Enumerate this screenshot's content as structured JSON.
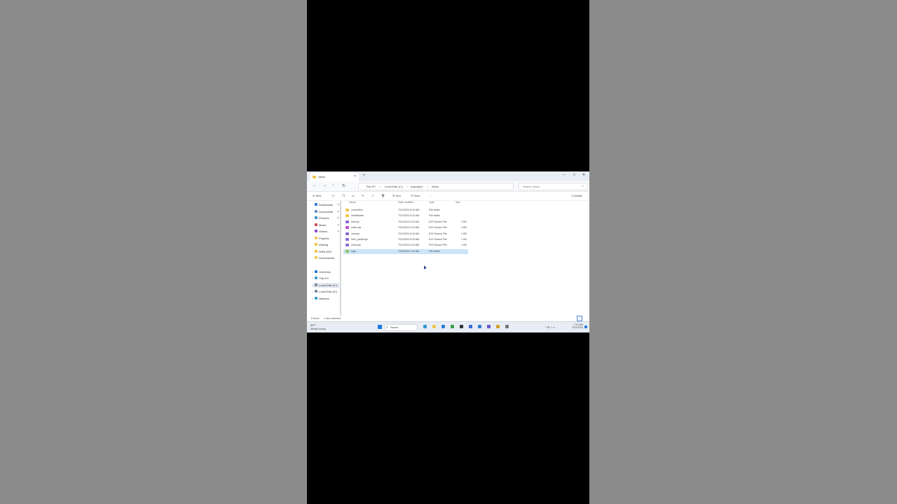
{
  "window": {
    "tab_title": "views",
    "tab_close": "×",
    "new_tab": "+",
    "controls": {
      "minimize": "–",
      "maximize": "□",
      "close": "✕"
    }
  },
  "addressbar": {
    "nav": {
      "back": "←",
      "forward": "→",
      "up": "↑",
      "refresh": "↻"
    },
    "crumbs": [
      "This PC",
      "Local Disk (C:)",
      "myproject",
      "views"
    ],
    "separator": "›",
    "search_placeholder": "Search views",
    "search_glyph": "⌕"
  },
  "toolbar": {
    "new": "New",
    "sort": "Sort",
    "view": "View",
    "more": "···",
    "details": "Details"
  },
  "nav_pane": {
    "quick_access": [
      {
        "label": "Downloads",
        "pin": "⊿",
        "color": "#2f7bd6"
      },
      {
        "label": "Documents",
        "pin": "⊿",
        "color": "#6a8fc7"
      },
      {
        "label": "Pictures",
        "pin": "⊿",
        "color": "#3c8fd0"
      },
      {
        "label": "Music",
        "pin": "⊿",
        "color": "#d64a5a"
      },
      {
        "label": "Videos",
        "pin": "⊿",
        "color": "#8a4ad6"
      },
      {
        "label": "Projects",
        "pin": "",
        "color": "#f3c44d"
      },
      {
        "label": "myblog",
        "pin": "",
        "color": "#f3c44d"
      },
      {
        "label": "WEB-DEV",
        "pin": "",
        "color": "#f3c44d"
      },
      {
        "label": "Screenshots",
        "pin": "",
        "color": "#f3c44d"
      }
    ],
    "drives": [
      {
        "label": "OneDrive",
        "color": "#2f7bd6",
        "selected": false
      },
      {
        "label": "This PC",
        "color": "#3aa0c8",
        "selected": false
      },
      {
        "label": "Local Disk (C:)",
        "color": "#7a8a9a",
        "selected": true
      },
      {
        "label": "Local Disk (D:)",
        "color": "#7a8a9a",
        "selected": false
      },
      {
        "label": "Network",
        "color": "#3aa0c8",
        "selected": false
      }
    ],
    "chevron": "›"
  },
  "file_list": {
    "headers": {
      "name": "Name",
      "date": "Date modified",
      "type": "Type",
      "size": "Size"
    },
    "rows": [
      {
        "name": "controllers",
        "date": "7/21/2024 5:10 AM",
        "type": "File folder",
        "size": "",
        "icon": "folder-icon",
        "color": "#f3c44d",
        "selected": false
      },
      {
        "name": "middleware",
        "date": "7/21/2024 5:10 AM",
        "type": "File folder",
        "size": "",
        "icon": "folder-icon",
        "color": "#f3c44d",
        "selected": false
      },
      {
        "name": "edit.ejs",
        "date": "7/21/2024 5:10 AM",
        "type": "EJS Source File",
        "size": "2 KB",
        "icon": "code-file-icon",
        "color": "#8a6ad6",
        "selected": false
      },
      {
        "name": "index.ejs",
        "date": "7/21/2024 5:10 AM",
        "type": "EJS Source File",
        "size": "2 KB",
        "icon": "code-file-icon",
        "color": "#c04ad6",
        "selected": false
      },
      {
        "name": "new.ejs",
        "date": "7/21/2024 5:10 AM",
        "type": "EJS Source File",
        "size": "2 KB",
        "icon": "code-file-icon",
        "color": "#8a6ad6",
        "selected": false
      },
      {
        "name": "new_partial.ejs",
        "date": "7/21/2024 5:10 AM",
        "type": "EJS Source File",
        "size": "1 KB",
        "icon": "code-file-icon",
        "color": "#8a6ad6",
        "selected": false
      },
      {
        "name": "show.ejs",
        "date": "7/21/2024 5:10 AM",
        "type": "EJS Source File",
        "size": "1 KB",
        "icon": "code-file-icon",
        "color": "#8a6ad6",
        "selected": false
      },
      {
        "name": "logs",
        "date": "7/21/2024 7:10 AM",
        "type": "File folder",
        "size": "",
        "icon": "folder-icon",
        "color": "#8fc45a",
        "selected": true
      }
    ]
  },
  "status_bar": {
    "item_count": "8 items",
    "selection": "1 item selected"
  },
  "taskbar": {
    "weather_temp": "80°F",
    "weather_desc": "Mostly cloudy",
    "search_placeholder": "Search",
    "search_glyph": "⌕",
    "apps": [
      {
        "name": "edge-icon",
        "color": "#2f9ad6"
      },
      {
        "name": "explorer-icon",
        "color": "#f3c44d"
      },
      {
        "name": "vscode-icon",
        "color": "#2f7bd6"
      },
      {
        "name": "chrome-icon",
        "color": "#3aa04a"
      },
      {
        "name": "terminal-icon",
        "color": "#333333"
      },
      {
        "name": "store-icon",
        "color": "#3a6ad6"
      },
      {
        "name": "mail-icon",
        "color": "#2f7bd6"
      },
      {
        "name": "teams-icon",
        "color": "#6a5ad6"
      },
      {
        "name": "photos-icon",
        "color": "#d6a02f"
      },
      {
        "name": "settings-icon",
        "color": "#777777"
      }
    ],
    "tray": "^ ⊡ ⌂ ◖",
    "time": "7:10 AM",
    "date": "7/21/2024"
  }
}
